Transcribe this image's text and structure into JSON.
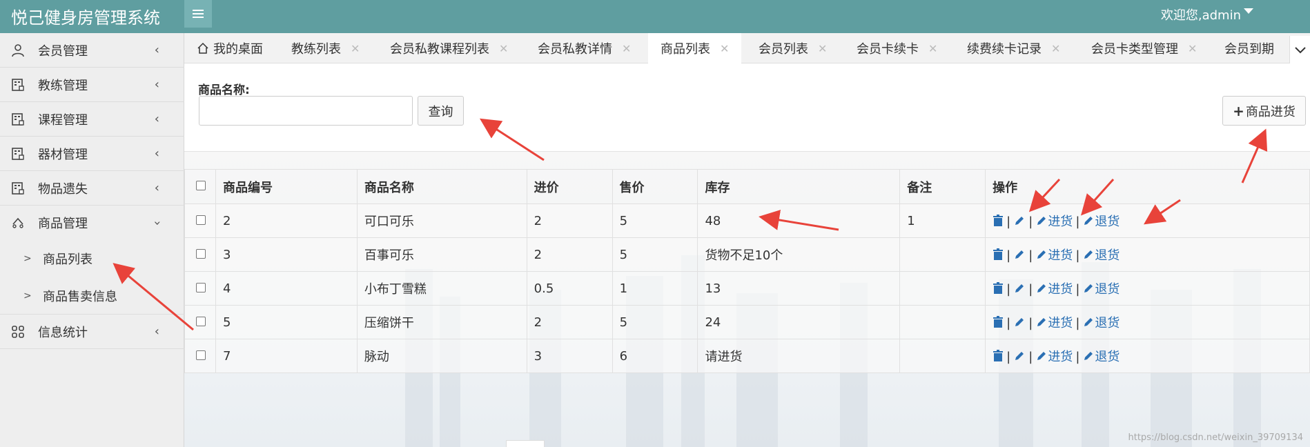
{
  "header": {
    "app_title": "悦己健身房管理系统",
    "welcome": "欢迎您,admin"
  },
  "sidebar": {
    "items": [
      {
        "label": "会员管理",
        "icon": "user-icon"
      },
      {
        "label": "教练管理",
        "icon": "building-icon"
      },
      {
        "label": "课程管理",
        "icon": "building-icon"
      },
      {
        "label": "器材管理",
        "icon": "building-icon"
      },
      {
        "label": "物品遗失",
        "icon": "building-icon"
      },
      {
        "label": "商品管理",
        "icon": "product-icon"
      },
      {
        "label": "信息统计",
        "icon": "grid-icon"
      }
    ],
    "sub_items": [
      {
        "label": "商品列表"
      },
      {
        "label": "商品售卖信息"
      }
    ]
  },
  "tabs": [
    {
      "label": "我的桌面"
    },
    {
      "label": "教练列表"
    },
    {
      "label": "会员私教课程列表"
    },
    {
      "label": "会员私教详情"
    },
    {
      "label": "商品列表"
    },
    {
      "label": "会员列表"
    },
    {
      "label": "会员卡续卡"
    },
    {
      "label": "续费续卡记录"
    },
    {
      "label": "会员卡类型管理"
    },
    {
      "label": "会员到期"
    }
  ],
  "search": {
    "label": "商品名称:",
    "value": "",
    "query_button": "查询",
    "purchase_button": "商品进货"
  },
  "table": {
    "columns": [
      "商品编号",
      "商品名称",
      "进价",
      "售价",
      "库存",
      "备注",
      "操作"
    ],
    "rows": [
      {
        "id": "2",
        "name": "可口可乐",
        "cost": "2",
        "price": "5",
        "stock": "48",
        "note": "1"
      },
      {
        "id": "3",
        "name": "百事可乐",
        "cost": "2",
        "price": "5",
        "stock": "货物不足10个",
        "note": ""
      },
      {
        "id": "4",
        "name": "小布丁雪糕",
        "cost": "0.5",
        "price": "1",
        "stock": "13",
        "note": ""
      },
      {
        "id": "5",
        "name": "压缩饼干",
        "cost": "2",
        "price": "5",
        "stock": "24",
        "note": ""
      },
      {
        "id": "7",
        "name": "脉动",
        "cost": "3",
        "price": "6",
        "stock": "请进货",
        "note": ""
      }
    ],
    "ops": {
      "restock": "进货",
      "return": "退货",
      "sep": "|"
    }
  },
  "footer": {
    "watermark": "https://blog.csdn.net/weixin_39709134"
  },
  "colors": {
    "header_bg": "#5f9ea0",
    "link": "#2a6fb3",
    "warning": "#e00000"
  }
}
